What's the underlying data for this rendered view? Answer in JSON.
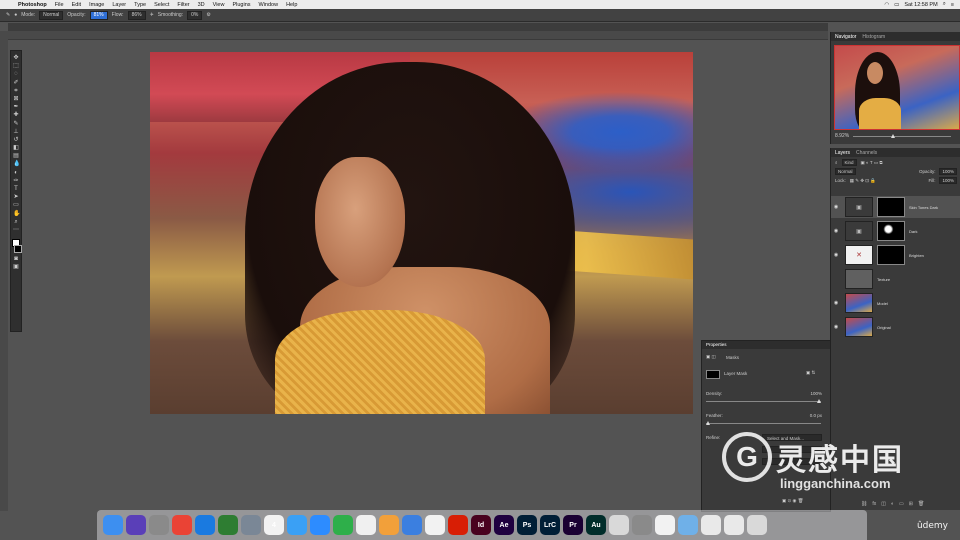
{
  "menubar": {
    "app": "Photoshop",
    "items": [
      "File",
      "Edit",
      "Image",
      "Layer",
      "Type",
      "Select",
      "Filter",
      "3D",
      "View",
      "Plugins",
      "Window",
      "Help"
    ],
    "clock": "Sat 12:58 PM"
  },
  "options": {
    "mode_label": "Mode:",
    "mode_value": "Normal",
    "opacity_label": "Opacity:",
    "opacity_value": "81%",
    "flow_label": "Flow:",
    "flow_value": "86%",
    "smoothing_label": "Smoothing:",
    "smoothing_value": "0%"
  },
  "navigator": {
    "tabs": [
      "Navigator",
      "Histogram"
    ],
    "zoom": "8.92%"
  },
  "layers": {
    "tabs": [
      "Layers",
      "Channels"
    ],
    "kind_label": "Kind",
    "blend_mode": "Normal",
    "opacity_label": "Opacity:",
    "opacity_value": "100%",
    "lock_label": "Lock:",
    "fill_label": "Fill:",
    "fill_value": "100%",
    "items": [
      {
        "name": "Skin Tones Dark"
      },
      {
        "name": "Dark"
      },
      {
        "name": "Brighten"
      },
      {
        "name": "Texture"
      },
      {
        "name": "Model"
      },
      {
        "name": "Original"
      }
    ]
  },
  "properties": {
    "title": "Properties",
    "type_label": "Masks",
    "mask_label": "Layer Mask",
    "density_label": "Density:",
    "density_value": "100%",
    "feather_label": "Feather:",
    "feather_value": "0.0 px",
    "refine_label": "Refine:",
    "select_mask": "Select and Mask..."
  },
  "dock": {
    "apps": [
      {
        "name": "Finder",
        "label": "",
        "color": "#3d8ff0"
      },
      {
        "name": "Siri",
        "label": "",
        "color": "#5a3fb8"
      },
      {
        "name": "Launchpad",
        "label": "",
        "color": "#8a8a8a"
      },
      {
        "name": "Chrome",
        "label": "",
        "color": "#ea4335"
      },
      {
        "name": "Safari",
        "label": "",
        "color": "#1a7ae0"
      },
      {
        "name": "Camtasia",
        "label": "",
        "color": "#2e7d32"
      },
      {
        "name": "Preview",
        "label": "",
        "color": "#7a8796"
      },
      {
        "name": "Calendar",
        "label": "4",
        "color": "#f2f2f2"
      },
      {
        "name": "Messages",
        "label": "",
        "color": "#3aa0f5"
      },
      {
        "name": "Zoom",
        "label": "",
        "color": "#2d8cff"
      },
      {
        "name": "WeChat",
        "label": "",
        "color": "#2eaf4a"
      },
      {
        "name": "Notes",
        "label": "",
        "color": "#f0f0f0"
      },
      {
        "name": "Pages",
        "label": "",
        "color": "#f2a03a"
      },
      {
        "name": "Keynote",
        "label": "",
        "color": "#3b7fe0"
      },
      {
        "name": "Music",
        "label": "",
        "color": "#f2f2f2"
      },
      {
        "name": "Acrobat",
        "label": "",
        "color": "#d81e05"
      },
      {
        "name": "InDesign",
        "label": "Id",
        "color": "#49021f"
      },
      {
        "name": "After Effects",
        "label": "Ae",
        "color": "#1f0040"
      },
      {
        "name": "Photoshop",
        "label": "Ps",
        "color": "#001e36"
      },
      {
        "name": "Lightroom Classic",
        "label": "LrC",
        "color": "#001e36"
      },
      {
        "name": "Premiere",
        "label": "Pr",
        "color": "#1a0033"
      },
      {
        "name": "Audition",
        "label": "Au",
        "color": "#002d2a"
      },
      {
        "name": "Books",
        "label": "",
        "color": "#d9d9d9"
      },
      {
        "name": "System Preferences",
        "label": "",
        "color": "#8a8a8a"
      },
      {
        "name": "Creative Cloud",
        "label": "",
        "color": "#f2f2f2"
      },
      {
        "name": "Downloads",
        "label": "",
        "color": "#6fb0e8"
      },
      {
        "name": "Screenshot",
        "label": "",
        "color": "#e9e9e9"
      },
      {
        "name": "Document",
        "label": "",
        "color": "#e9e9e9"
      },
      {
        "name": "Trash",
        "label": "",
        "color": "#d9d9d9"
      }
    ]
  },
  "watermark": {
    "logo": "G",
    "name": "灵感中国",
    "url": "lingganchina.com"
  },
  "udemy": "ûdemy"
}
